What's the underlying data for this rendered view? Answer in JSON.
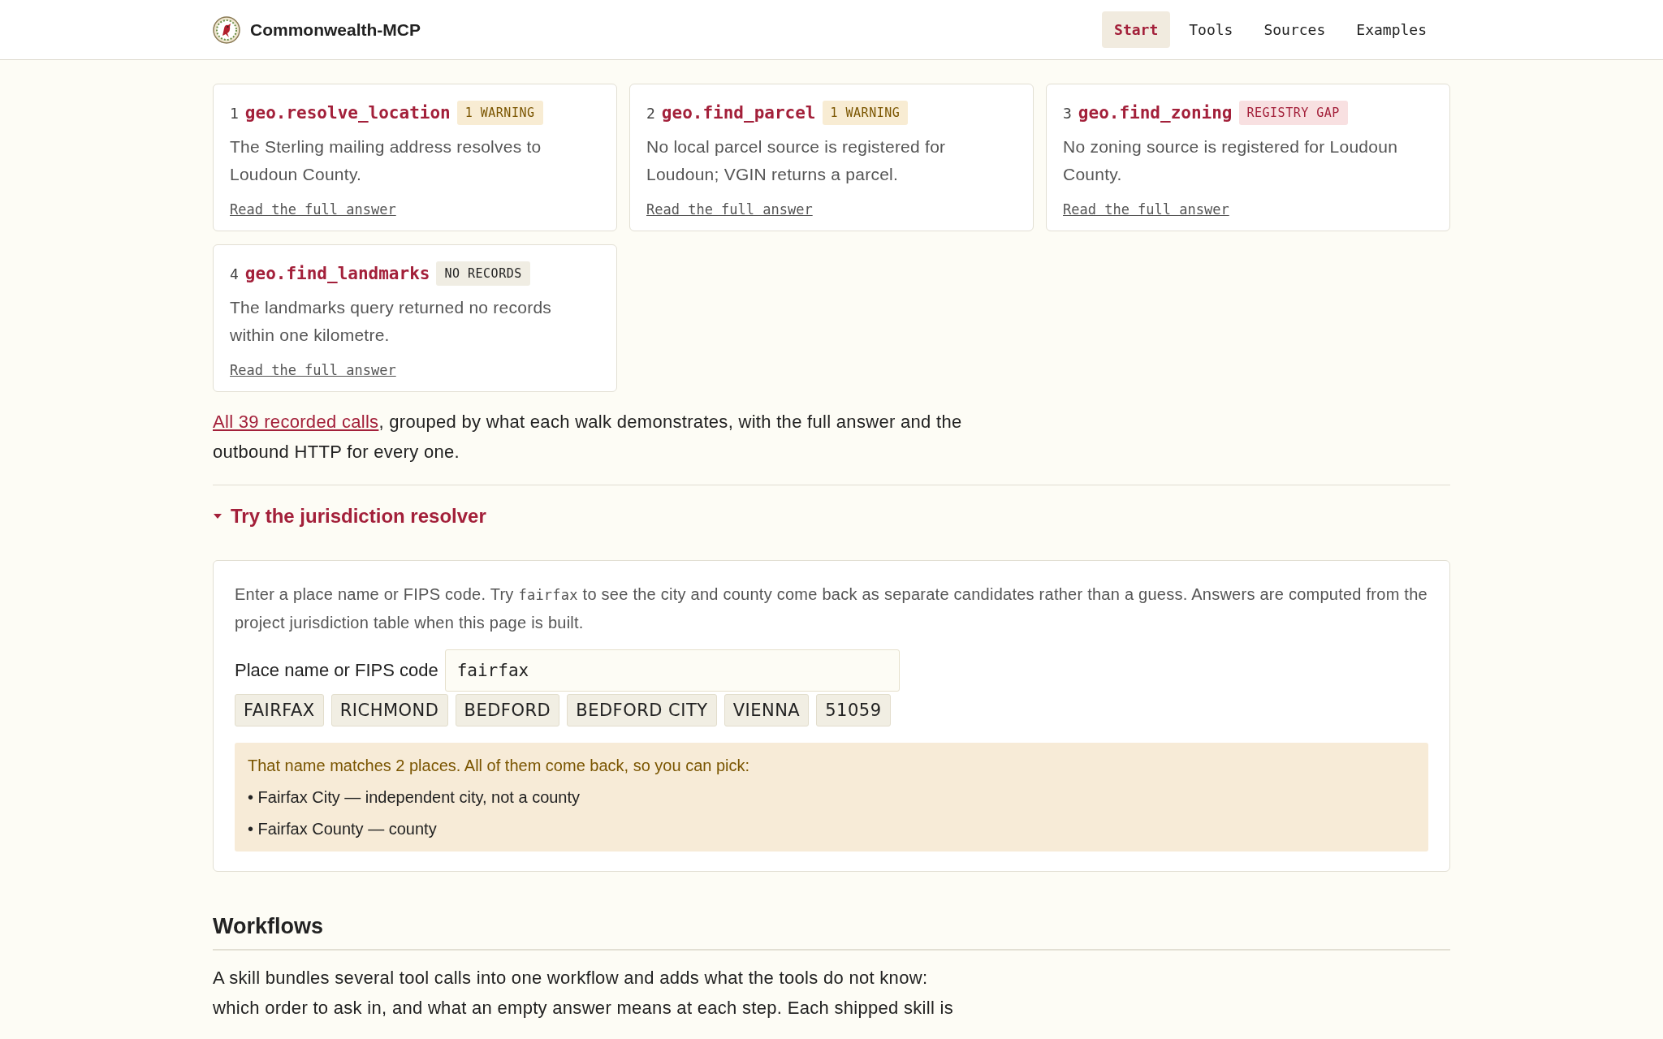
{
  "header": {
    "brand": "Commonwealth-MCP",
    "nav": [
      {
        "label": "Start",
        "selected": true
      },
      {
        "label": "Tools",
        "selected": false
      },
      {
        "label": "Sources",
        "selected": false
      },
      {
        "label": "Examples",
        "selected": false
      }
    ]
  },
  "calls": [
    {
      "number": "1",
      "tool": "geo.resolve_location",
      "badge": "1 WARNING",
      "kind": "warning",
      "summary": "The Sterling mailing address resolves to Loudoun County.",
      "link": "Read the full answer"
    },
    {
      "number": "2",
      "tool": "geo.find_parcel",
      "badge": "1 WARNING",
      "kind": "warning",
      "summary": "No local parcel source is registered for Loudoun; VGIN returns a parcel.",
      "link": "Read the full answer"
    },
    {
      "number": "3",
      "tool": "geo.find_zoning",
      "badge": "REGISTRY GAP",
      "kind": "gap",
      "summary": "No zoning source is registered for Loudoun County.",
      "link": "Read the full answer"
    },
    {
      "number": "4",
      "tool": "geo.find_landmarks",
      "badge": "NO RECORDS",
      "kind": "empty",
      "summary": "The landmarks query returned no records within one kilometre.",
      "link": "Read the full answer"
    }
  ],
  "intro": {
    "link": "All 39 recorded calls",
    "text": ", grouped by what each walk demonstrates, with the full answer and the outbound HTTP for every one."
  },
  "resolver": {
    "title": "Try the jurisdiction resolver",
    "expanded": true,
    "description": {
      "before": "Enter a place name or FIPS code. Try ",
      "code": "fairfax",
      "after": " to see the city and county come back as separate candidates rather than a guess. Answers are computed from the project jurisdiction table when this page is built."
    },
    "field_label": "Place name or FIPS code",
    "value": "fairfax",
    "examples": [
      "FAIRFAX",
      "RICHMOND",
      "BEDFORD",
      "BEDFORD CITY",
      "VIENNA",
      "51059"
    ],
    "result": {
      "heading": "That name matches 2 places. All of them come back, so you can pick:",
      "items": [
        "• Fairfax City — independent city, not a county",
        "• Fairfax County — county"
      ]
    }
  },
  "workflows": {
    "heading": "Workflows",
    "paragraph": "A skill bundles several tool calls into one workflow and adds what the tools do not know: which order to ask in, and what an empty answer means at each step. Each shipped skill is"
  }
}
